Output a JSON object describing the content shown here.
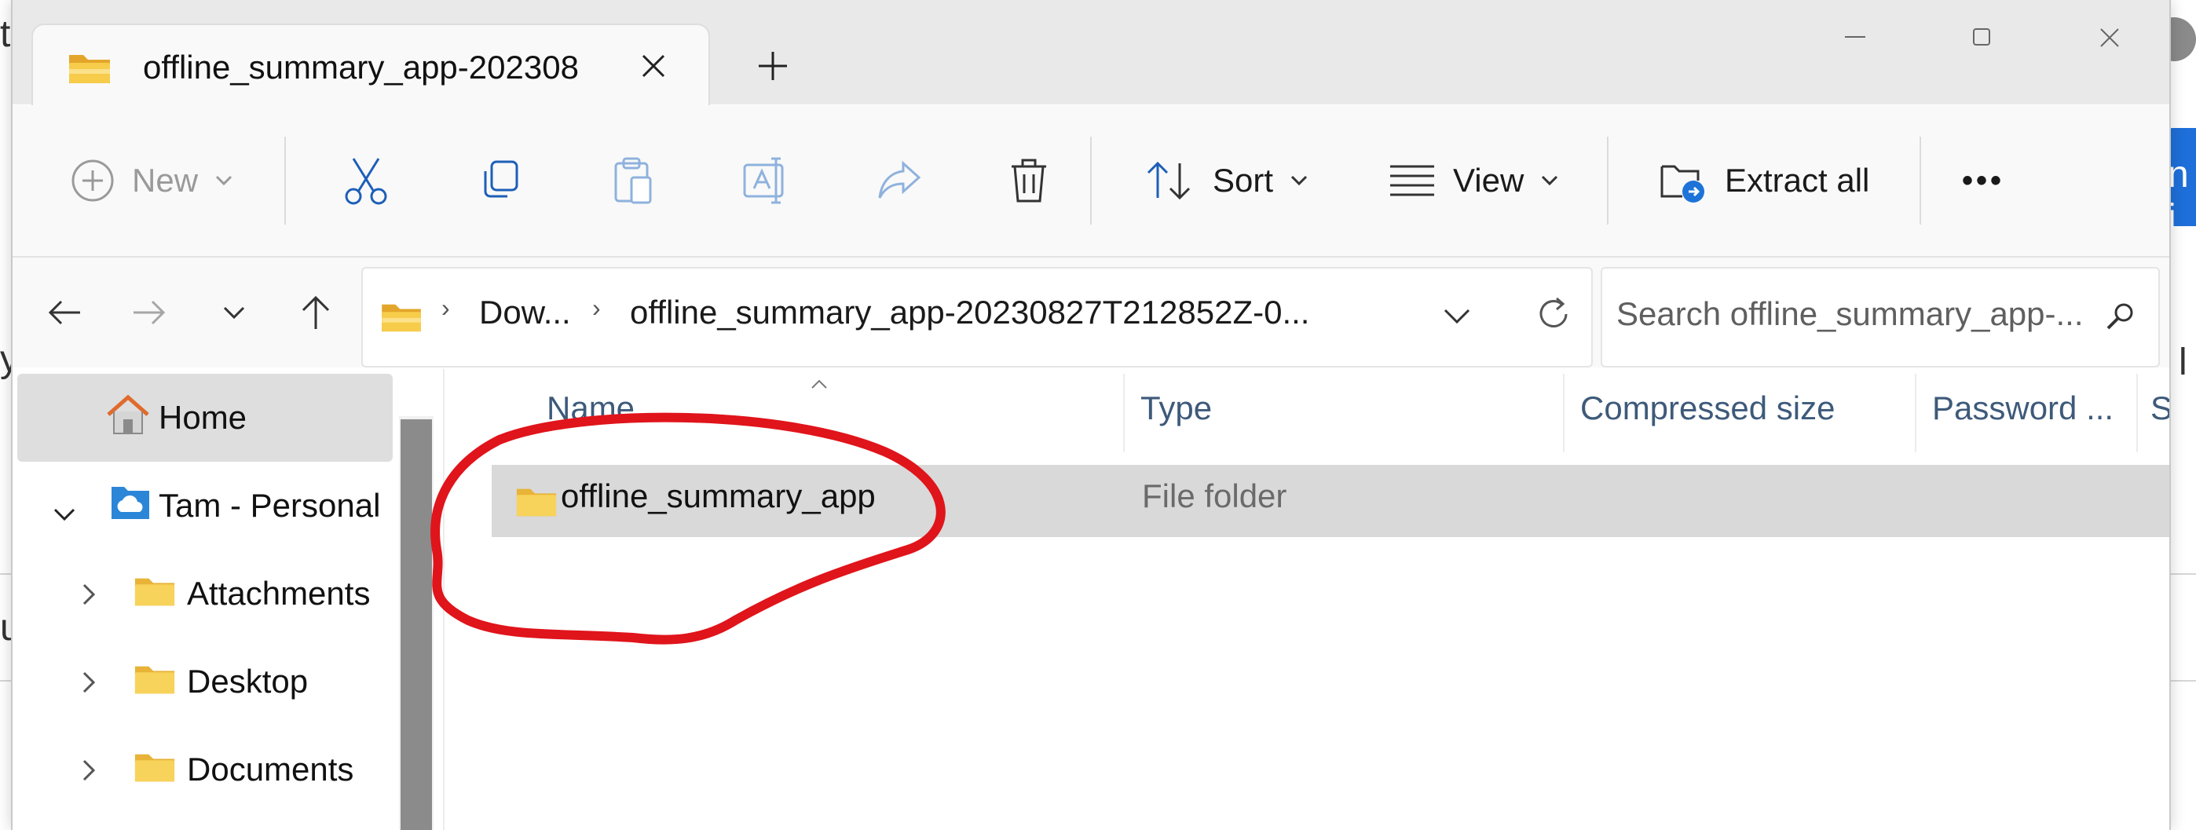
{
  "background": {
    "left_partial_texts": [
      "t",
      "y",
      "u"
    ],
    "right_partial_texts": [
      "n i",
      "l"
    ]
  },
  "tab": {
    "title": "offline_summary_app-202308",
    "folder_icon": "folder-icon",
    "close_icon": "close-icon",
    "new_tab_icon": "plus-icon"
  },
  "window_controls": {
    "minimize_icon": "minimize-icon",
    "maximize_icon": "maximize-icon",
    "close_icon": "window-close-icon"
  },
  "toolbar": {
    "new_label": "New",
    "sort_label": "Sort",
    "view_label": "View",
    "extract_label": "Extract all",
    "more_label": "•••"
  },
  "address": {
    "crumbs": [
      "Dow...",
      "offline_summary_app-20230827T212852Z-0..."
    ]
  },
  "search": {
    "placeholder": "Search offline_summary_app-..."
  },
  "nav_pane": {
    "items": [
      {
        "label": "Home",
        "icon": "home-icon"
      },
      {
        "label": "Tam - Personal",
        "icon": "onedrive-icon"
      },
      {
        "label": "Attachments",
        "icon": "folder-icon"
      },
      {
        "label": "Desktop",
        "icon": "folder-icon"
      },
      {
        "label": "Documents",
        "icon": "folder-icon"
      }
    ]
  },
  "columns": [
    "Name",
    "Type",
    "Compressed size",
    "Password ...",
    "Siz"
  ],
  "files": [
    {
      "name": "offline_summary_app",
      "type": "File folder"
    }
  ],
  "colors": {
    "accent": "#1e6fd9",
    "annotation": "#e0141b",
    "folder": "#f5c542"
  }
}
